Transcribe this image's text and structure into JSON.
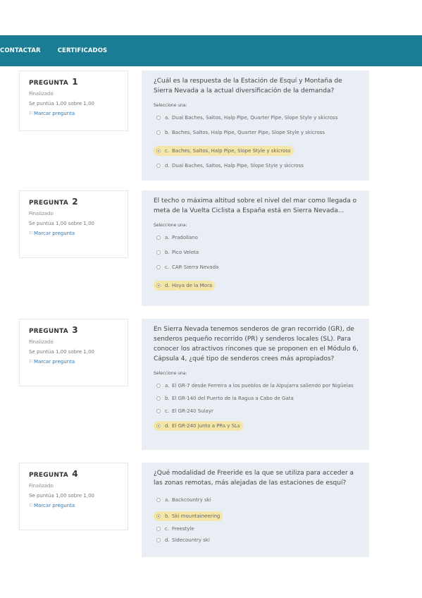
{
  "nav": {
    "contact": "CONTACTAR",
    "certificates": "CERTIFICADOS"
  },
  "questions": [
    {
      "title": "PREGUNTA",
      "number": "1",
      "state": "Finalizado",
      "grade": "Se puntúa 1,00 sobre 1,00",
      "flag": "Marcar pregunta",
      "text": "¿Cuál es la respuesta de la Estación de Esquí y Montaña de Sierra Nevada a la actual diversificación de la demanda?",
      "prompt": "Seleccione una:",
      "options": [
        {
          "letter": "a.",
          "text": "Dual Baches, Saltos, Halp Pipe, Quarter Pipe, Slope Style y skicross"
        },
        {
          "letter": "b.",
          "text": "Baches, Saltos, Halp Pipe, Quarter Pipe, Slope Style y skicross"
        },
        {
          "letter": "c.",
          "text": "Baches, Saltos, Halp Pipe, Slope Style y skicross"
        },
        {
          "letter": "d.",
          "text": "Dual Baches, Saltos, Halp Pipe, Slope Style y skicross"
        }
      ],
      "selected": 2
    },
    {
      "title": "PREGUNTA",
      "number": "2",
      "state": "Finalizado",
      "grade": "Se puntúa 1,00 sobre 1,00",
      "flag": "Marcar pregunta",
      "text": "El techo o máxima altitud sobre el nivel del mar como llegada o meta de la Vuelta Ciclista a España está en Sierra Nevada...",
      "prompt": "Seleccione una:",
      "options": [
        {
          "letter": "a.",
          "text": "Pradollano"
        },
        {
          "letter": "b.",
          "text": "Pico Veleta"
        },
        {
          "letter": "c.",
          "text": "CAR Sierra Nevada"
        },
        {
          "letter": "d.",
          "text": "Hoya de la Mora"
        }
      ],
      "selected": 3
    },
    {
      "title": "PREGUNTA",
      "number": "3",
      "state": "Finalizado",
      "grade": "Se puntúa 1,00 sobre 1,00",
      "flag": "Marcar pregunta",
      "text": "En Sierra Nevada tenemos senderos de gran recorrido (GR), de senderos pequeño recorrido (PR) y senderos locales (SL). Para conocer los atractivos rincones que se proponen en el Módulo 6, Cápsula 4, ¿qué tipo de senderos crees más apropiados?",
      "prompt": "Seleccione una:",
      "options": [
        {
          "letter": "a.",
          "text": "El GR-7 desde Ferreira a los pueblos de la Alpujarra saliendo por Nigüelas"
        },
        {
          "letter": "b.",
          "text": "El GR-140 del Puerto de la Ragua a Cabo de Gata"
        },
        {
          "letter": "c.",
          "text": "El GR-240 Sulayr"
        },
        {
          "letter": "d.",
          "text": "El GR-240 junto a PRs y SLs"
        }
      ],
      "selected": 3
    },
    {
      "title": "PREGUNTA",
      "number": "4",
      "state": "Finalizado",
      "grade": "Se puntúa 1,00 sobre 1,00",
      "flag": "Marcar pregunta",
      "text": "¿Qué modalidad de Freeride es la que se utiliza para acceder a las zonas remotas, más alejadas de las estaciones de esquí?",
      "prompt": "",
      "options": [
        {
          "letter": "a.",
          "text": "Backcountry ski"
        },
        {
          "letter": "b.",
          "text": "Ski mountaineering"
        },
        {
          "letter": "c.",
          "text": "Freestyle"
        },
        {
          "letter": "d.",
          "text": "Sidecountry ski"
        }
      ],
      "selected": 1
    }
  ]
}
